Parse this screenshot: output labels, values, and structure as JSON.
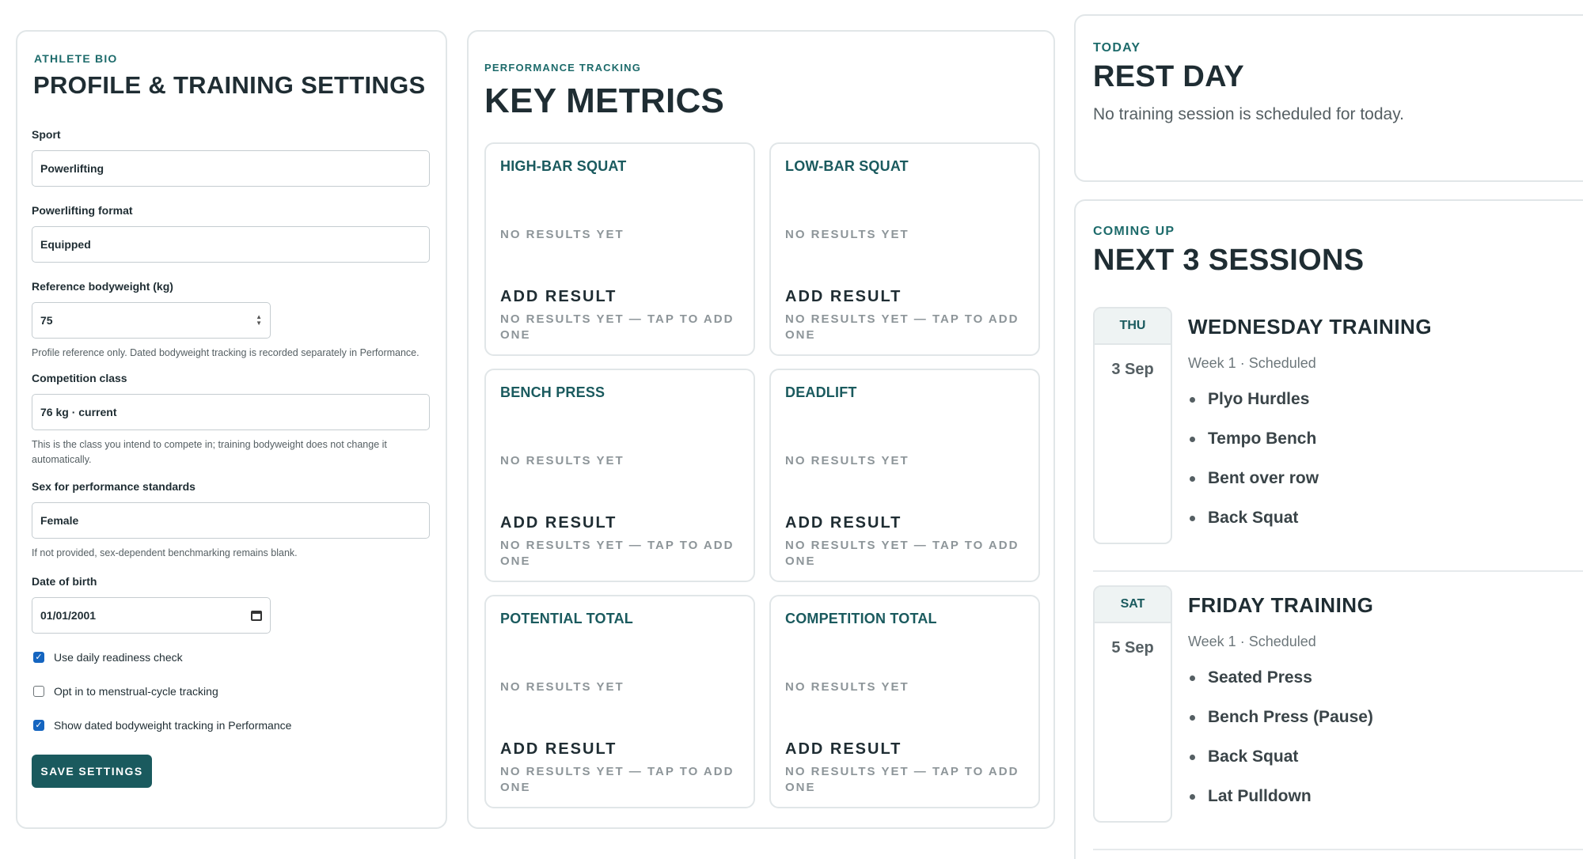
{
  "profile": {
    "eyebrow": "ATHLETE BIO",
    "title": "PROFILE & TRAINING SETTINGS",
    "sport": {
      "label": "Sport",
      "value": "Powerlifting"
    },
    "format": {
      "label": "Powerlifting format",
      "value": "Equipped"
    },
    "bodyweight": {
      "label": "Reference bodyweight (kg)",
      "value": "75",
      "help": "Profile reference only. Dated bodyweight tracking is recorded separately in Performance."
    },
    "competition_class": {
      "label": "Competition class",
      "value": "76 kg · current",
      "help": "This is the class you intend to compete in; training bodyweight does not change it automatically."
    },
    "sex": {
      "label": "Sex for performance standards",
      "value": "Female",
      "help": "If not provided, sex-dependent benchmarking remains blank."
    },
    "dob": {
      "label": "Date of birth",
      "value": "01/01/2001"
    },
    "checkboxes": [
      {
        "label": "Use daily readiness check",
        "checked": true
      },
      {
        "label": "Opt in to menstrual-cycle tracking",
        "checked": false
      },
      {
        "label": "Show dated bodyweight tracking in Performance",
        "checked": true
      }
    ],
    "save_label": "SAVE SETTINGS"
  },
  "metrics": {
    "eyebrow": "PERFORMANCE TRACKING",
    "title": "KEY METRICS",
    "cards": [
      {
        "title": "HIGH-BAR SQUAT",
        "empty": "NO RESULTS YET",
        "add": "ADD RESULT",
        "hint": "NO RESULTS YET — TAP TO ADD ONE"
      },
      {
        "title": "LOW-BAR SQUAT",
        "empty": "NO RESULTS YET",
        "add": "ADD RESULT",
        "hint": "NO RESULTS YET — TAP TO ADD ONE"
      },
      {
        "title": "BENCH PRESS",
        "empty": "NO RESULTS YET",
        "add": "ADD RESULT",
        "hint": "NO RESULTS YET — TAP TO ADD ONE"
      },
      {
        "title": "DEADLIFT",
        "empty": "NO RESULTS YET",
        "add": "ADD RESULT",
        "hint": "NO RESULTS YET — TAP TO ADD ONE"
      },
      {
        "title": "POTENTIAL TOTAL",
        "empty": "NO RESULTS YET",
        "add": "ADD RESULT",
        "hint": "NO RESULTS YET — TAP TO ADD ONE"
      },
      {
        "title": "COMPETITION TOTAL",
        "empty": "NO RESULTS YET",
        "add": "ADD RESULT",
        "hint": "NO RESULTS YET — TAP TO ADD ONE"
      }
    ]
  },
  "today": {
    "eyebrow": "TODAY",
    "title": "REST DAY",
    "message": "No training session is scheduled for today."
  },
  "upcoming": {
    "eyebrow": "COMING UP",
    "title": "NEXT 3 SESSIONS",
    "sessions": [
      {
        "dow": "THU",
        "date": "3 Sep",
        "title": "WEDNESDAY TRAINING",
        "meta": "Week 1 · Scheduled",
        "exercises": [
          "Plyo Hurdles",
          "Tempo Bench",
          "Bent over row",
          "Back Squat"
        ]
      },
      {
        "dow": "SAT",
        "date": "5 Sep",
        "title": "FRIDAY TRAINING",
        "meta": "Week 1 · Scheduled",
        "exercises": [
          "Seated Press",
          "Bench Press (Pause)",
          "Back Squat",
          "Lat Pulldown"
        ]
      }
    ]
  }
}
